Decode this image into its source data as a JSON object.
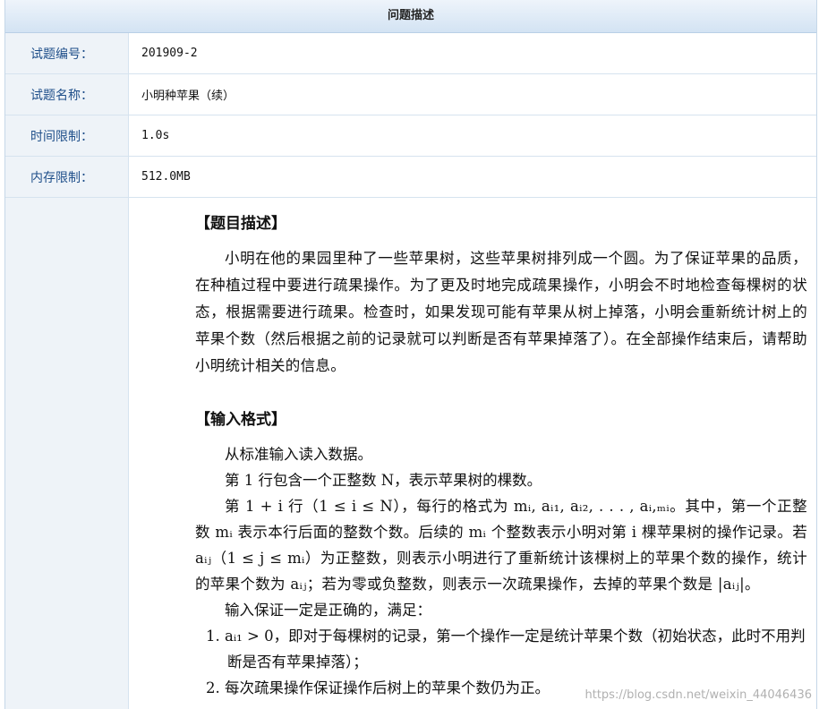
{
  "header": {
    "title": "问题描述"
  },
  "info_rows": [
    {
      "label": "试题编号：",
      "value": "201909-2"
    },
    {
      "label": "试题名称：",
      "value": "小明种苹果（续）"
    },
    {
      "label": "时间限制：",
      "value": "1.0s"
    },
    {
      "label": "内存限制：",
      "value": "512.0MB"
    }
  ],
  "description": {
    "title": "【题目描述】",
    "text": "小明在他的果园里种了一些苹果树，这些苹果树排列成一个圆。为了保证苹果的品质，在种植过程中要进行疏果操作。为了更及时地完成疏果操作，小明会不时地检查每棵树的状态，根据需要进行疏果。检查时，如果发现可能有苹果从树上掉落，小明会重新统计树上的苹果个数（然后根据之前的记录就可以判断是否有苹果掉落了）。在全部操作结束后，请帮助小明统计相关的信息。"
  },
  "input_format": {
    "title": "【输入格式】",
    "line1": "从标准输入读入数据。",
    "line2": "第 1 行包含一个正整数 N，表示苹果树的棵数。",
    "line3": "第 1 + i 行（1 ≤ i ≤ N），每行的格式为 mᵢ, aᵢ₁, aᵢ₂, . . . , aᵢ,ₘᵢ。其中，第一个正整数 mᵢ 表示本行后面的整数个数。后续的 mᵢ 个整数表示小明对第 i 棵苹果树的操作记录。若 aᵢⱼ（1 ≤ j ≤ mᵢ）为正整数，则表示小明进行了重新统计该棵树上的苹果个数的操作，统计的苹果个数为 aᵢⱼ；若为零或负整数，则表示一次疏果操作，去掉的苹果个数是 |aᵢⱼ|。",
    "line4": "输入保证一定是正确的，满足：",
    "items": [
      "1. aᵢ₁ > 0，即对于每棵树的记录，第一个操作一定是统计苹果个数（初始状态，此时不用判断是否有苹果掉落）；",
      "2. 每次疏果操作保证操作后树上的苹果个数仍为正。"
    ]
  },
  "watermark": "https://blog.csdn.net/weixin_44046436"
}
